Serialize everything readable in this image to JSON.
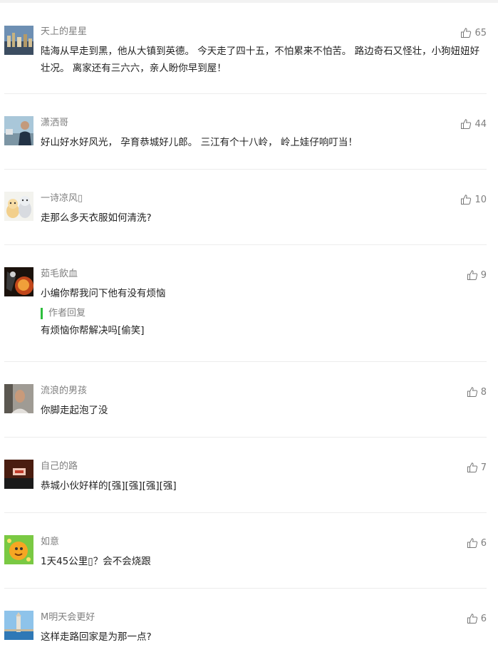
{
  "comments": [
    {
      "nickname": "天上的星星",
      "content": "陆海从早走到黑，他从大镇到英德。 今天走了四十五，不怕累来不怕苦。 路边奇石又怪壮，小狗妞妞好壮况。 离家还有三六六，亲人盼你早到屋！",
      "likes": "65"
    },
    {
      "nickname": "潇洒哥",
      "content": "好山好水好风光， 孕育恭城好儿郎。 三江有个十八岭， 岭上娃仔响叮当！",
      "likes": "44"
    },
    {
      "nickname": "一诗凉风▯",
      "content": "走那么多天衣服如何清洗?",
      "likes": "10"
    },
    {
      "nickname": "茹毛飲血",
      "content": "小编你帮我问下他有没有烦恼",
      "likes": "9",
      "author_reply": {
        "label": "作者回复",
        "content": "有烦恼你帮解决吗[偷笑]"
      }
    },
    {
      "nickname": "流浪的男孩",
      "content": "你脚走起泡了没",
      "likes": "8"
    },
    {
      "nickname": "自己的路",
      "content": "恭城小伙好样的[强][强][强][强]",
      "likes": "7"
    },
    {
      "nickname": "如意",
      "content": "1天45公里▯？会不会烧跟",
      "likes": "6"
    },
    {
      "nickname": "M明天会更好",
      "content": "这样走路回家是为那一点?",
      "likes": "6"
    }
  ],
  "icons": {
    "like": "thumbs-up-icon"
  }
}
